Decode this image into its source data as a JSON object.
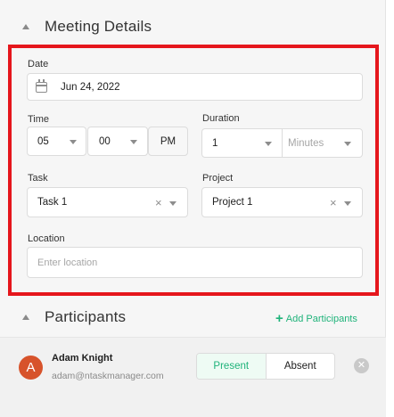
{
  "meeting_details": {
    "title": "Meeting Details",
    "date": {
      "label": "Date",
      "value": "Jun 24, 2022"
    },
    "time": {
      "label": "Time",
      "hour": "05",
      "minute": "00",
      "period": "PM"
    },
    "duration": {
      "label": "Duration",
      "value": "1",
      "unit_placeholder": "Minutes"
    },
    "task": {
      "label": "Task",
      "value": "Task 1"
    },
    "project": {
      "label": "Project",
      "value": "Project 1"
    },
    "location": {
      "label": "Location",
      "placeholder": "Enter location"
    }
  },
  "participants": {
    "title": "Participants",
    "add_label": "Add Participants",
    "list": [
      {
        "initial": "A",
        "name": "Adam Knight",
        "email": "adam@ntaskmanager.com",
        "present_label": "Present",
        "absent_label": "Absent"
      }
    ]
  },
  "colors": {
    "accent_green": "#1fb37a",
    "highlight_red": "#e5161c",
    "avatar_bg": "#d7532b"
  }
}
